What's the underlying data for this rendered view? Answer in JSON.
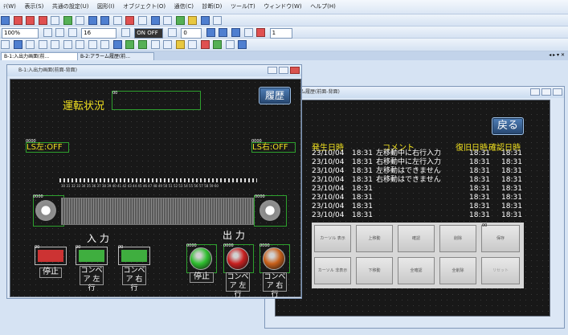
{
  "menu": [
    "ﾃ(W)",
    "表示(S)",
    "共通の設定(U)",
    "図形(I)",
    "オブジェクト(O)",
    "通信(C)",
    "診断(D)",
    "ツール(T)",
    "ウィンドウ(W)",
    "ヘルプ(H)"
  ],
  "toolbar": {
    "zoom": "100%",
    "font_size": "16",
    "on_off": "ON OFF",
    "counter": "0",
    "page": "1"
  },
  "tabs": [
    {
      "label": "B-1:入出力画面(前..."
    },
    {
      "label": "B-2:アラーム履歴(前..."
    }
  ],
  "tab_controls": "◂ ▸ ▾ ✕",
  "window_main": {
    "title": "B-1:入出力画面(前面-背面)",
    "status_label": "運転状況",
    "status_id": "00",
    "history_button": "履歴",
    "left_indicator": {
      "id": "0000",
      "text": "LS左:OFF"
    },
    "right_indicator": {
      "id": "0000",
      "text": "LS右:OFF"
    },
    "conveyor_left_id": "0000",
    "conveyor_right_id": "0000",
    "conveyor_scale": "30 31 32 33 34 35 36 37 38 39 40 41 42 43 44 45 46 47 48 49 50 51 52 53 54 55 56 57 58 59 60",
    "input_heading": "入 力",
    "output_heading": "出 力",
    "inputs": [
      {
        "id": "00",
        "label": "停止",
        "color": "#cc3333"
      },
      {
        "id": "00",
        "label": "コンベア 左行",
        "color": "#3fae3f"
      },
      {
        "id": "00",
        "label": "コンベア 右行",
        "color": "#3fae3f"
      }
    ],
    "outputs": [
      {
        "id": "0000",
        "label": "停止",
        "color": "#2fbf2f"
      },
      {
        "id": "0000",
        "label": "コンベア 左行",
        "color": "#c82020"
      },
      {
        "id": "0000",
        "label": "コンベア 右行",
        "color": "#c8601a"
      }
    ]
  },
  "window_alarm": {
    "title": "B-2:アラーム履歴(前面-背面)",
    "back_button": "戻る",
    "columns": [
      "発生日時",
      "コメント",
      "復旧日時",
      "確認日時"
    ],
    "rows": [
      {
        "date": "23/10/04",
        "time": "18:31",
        "comment": "左移動中に右行入力",
        "rec": "18:31",
        "conf": "18:31"
      },
      {
        "date": "23/10/04",
        "time": "18:31",
        "comment": "右移動中に左行入力",
        "rec": "18:31",
        "conf": "18:31"
      },
      {
        "date": "23/10/04",
        "time": "18:31",
        "comment": "左移動はできません",
        "rec": "18:31",
        "conf": "18:31"
      },
      {
        "date": "23/10/04",
        "time": "18:31",
        "comment": "右移動はできません",
        "rec": "18:31",
        "conf": "18:31"
      },
      {
        "date": "23/10/04",
        "time": "18:31",
        "comment": "",
        "rec": "18:31",
        "conf": "18:31"
      },
      {
        "date": "23/10/04",
        "time": "18:31",
        "comment": "",
        "rec": "18:31",
        "conf": "18:31"
      },
      {
        "date": "23/10/04",
        "time": "18:31",
        "comment": "",
        "rec": "18:31",
        "conf": "18:31"
      },
      {
        "date": "23/10/04",
        "time": "18:31",
        "comment": "",
        "rec": "18:31",
        "conf": "18:31"
      }
    ],
    "buttons_row1": [
      "カーソル 表示",
      "上移動",
      "確認",
      "削除",
      "保存"
    ],
    "buttons_row2": [
      "カーソル 非表示",
      "下移動",
      "全確認",
      "全削除",
      "リセット"
    ],
    "save_id": "00"
  }
}
